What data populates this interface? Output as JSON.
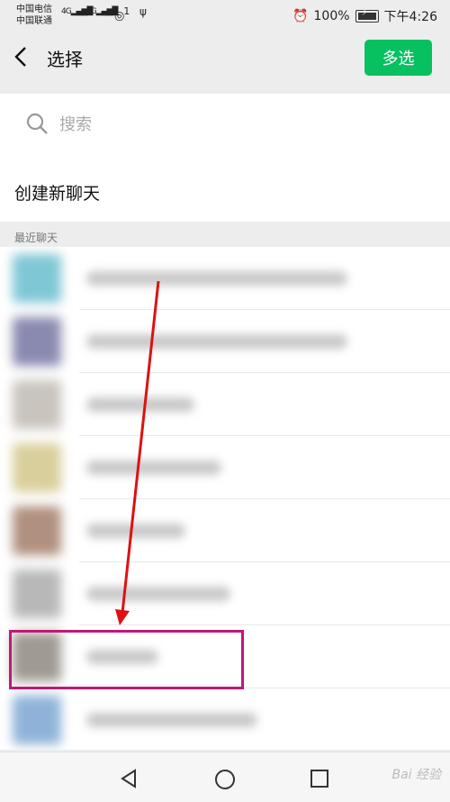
{
  "status": {
    "carrier1": "中国电信",
    "carrier2": "中国联通",
    "sig1": "4G",
    "sig2": "3G",
    "wifi_badge": "1",
    "battery": "100%",
    "time": "下午4:26"
  },
  "header": {
    "title": "选择",
    "multi_select": "多选"
  },
  "search": {
    "placeholder": "搜索"
  },
  "new_chat": "创建新聊天",
  "section_recent": "最近聊天",
  "watermark": "Bai 经验",
  "colors": {
    "accent": "#07c160",
    "highlight": "#c0187a",
    "arrow": "#d11"
  },
  "contacts": [
    {
      "avatar": "#7fc7d5",
      "name_w": 290
    },
    {
      "avatar": "#8a8ab0",
      "name_w": 290
    },
    {
      "avatar": "#c9c4bd",
      "name_w": 120
    },
    {
      "avatar": "#d9cf9c",
      "name_w": 150
    },
    {
      "avatar": "#b0907e",
      "name_w": 110
    },
    {
      "avatar": "#b8b8b8",
      "name_w": 160
    },
    {
      "avatar": "#9f9a92",
      "name_w": 80
    },
    {
      "avatar": "#8fb3d8",
      "name_w": 190
    }
  ]
}
